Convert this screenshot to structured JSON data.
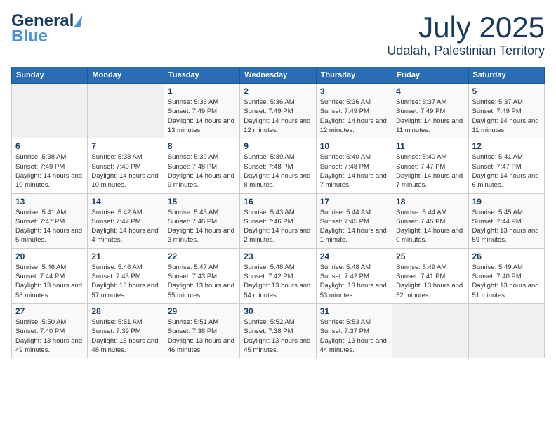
{
  "header": {
    "logo_general": "General",
    "logo_blue": "Blue",
    "month": "July 2025",
    "location": "Udalah, Palestinian Territory"
  },
  "weekdays": [
    "Sunday",
    "Monday",
    "Tuesday",
    "Wednesday",
    "Thursday",
    "Friday",
    "Saturday"
  ],
  "weeks": [
    [
      {
        "day": "",
        "info": ""
      },
      {
        "day": "",
        "info": ""
      },
      {
        "day": "1",
        "info": "Sunrise: 5:36 AM\nSunset: 7:49 PM\nDaylight: 14 hours and 13 minutes."
      },
      {
        "day": "2",
        "info": "Sunrise: 5:36 AM\nSunset: 7:49 PM\nDaylight: 14 hours and 12 minutes."
      },
      {
        "day": "3",
        "info": "Sunrise: 5:36 AM\nSunset: 7:49 PM\nDaylight: 14 hours and 12 minutes."
      },
      {
        "day": "4",
        "info": "Sunrise: 5:37 AM\nSunset: 7:49 PM\nDaylight: 14 hours and 11 minutes."
      },
      {
        "day": "5",
        "info": "Sunrise: 5:37 AM\nSunset: 7:49 PM\nDaylight: 14 hours and 11 minutes."
      }
    ],
    [
      {
        "day": "6",
        "info": "Sunrise: 5:38 AM\nSunset: 7:49 PM\nDaylight: 14 hours and 10 minutes."
      },
      {
        "day": "7",
        "info": "Sunrise: 5:38 AM\nSunset: 7:49 PM\nDaylight: 14 hours and 10 minutes."
      },
      {
        "day": "8",
        "info": "Sunrise: 5:39 AM\nSunset: 7:48 PM\nDaylight: 14 hours and 9 minutes."
      },
      {
        "day": "9",
        "info": "Sunrise: 5:39 AM\nSunset: 7:48 PM\nDaylight: 14 hours and 8 minutes."
      },
      {
        "day": "10",
        "info": "Sunrise: 5:40 AM\nSunset: 7:48 PM\nDaylight: 14 hours and 7 minutes."
      },
      {
        "day": "11",
        "info": "Sunrise: 5:40 AM\nSunset: 7:47 PM\nDaylight: 14 hours and 7 minutes."
      },
      {
        "day": "12",
        "info": "Sunrise: 5:41 AM\nSunset: 7:47 PM\nDaylight: 14 hours and 6 minutes."
      }
    ],
    [
      {
        "day": "13",
        "info": "Sunrise: 5:41 AM\nSunset: 7:47 PM\nDaylight: 14 hours and 5 minutes."
      },
      {
        "day": "14",
        "info": "Sunrise: 5:42 AM\nSunset: 7:47 PM\nDaylight: 14 hours and 4 minutes."
      },
      {
        "day": "15",
        "info": "Sunrise: 5:43 AM\nSunset: 7:46 PM\nDaylight: 14 hours and 3 minutes."
      },
      {
        "day": "16",
        "info": "Sunrise: 5:43 AM\nSunset: 7:46 PM\nDaylight: 14 hours and 2 minutes."
      },
      {
        "day": "17",
        "info": "Sunrise: 5:44 AM\nSunset: 7:45 PM\nDaylight: 14 hours and 1 minute."
      },
      {
        "day": "18",
        "info": "Sunrise: 5:44 AM\nSunset: 7:45 PM\nDaylight: 14 hours and 0 minutes."
      },
      {
        "day": "19",
        "info": "Sunrise: 5:45 AM\nSunset: 7:44 PM\nDaylight: 13 hours and 59 minutes."
      }
    ],
    [
      {
        "day": "20",
        "info": "Sunrise: 5:46 AM\nSunset: 7:44 PM\nDaylight: 13 hours and 58 minutes."
      },
      {
        "day": "21",
        "info": "Sunrise: 5:46 AM\nSunset: 7:43 PM\nDaylight: 13 hours and 57 minutes."
      },
      {
        "day": "22",
        "info": "Sunrise: 5:47 AM\nSunset: 7:43 PM\nDaylight: 13 hours and 55 minutes."
      },
      {
        "day": "23",
        "info": "Sunrise: 5:48 AM\nSunset: 7:42 PM\nDaylight: 13 hours and 54 minutes."
      },
      {
        "day": "24",
        "info": "Sunrise: 5:48 AM\nSunset: 7:42 PM\nDaylight: 13 hours and 53 minutes."
      },
      {
        "day": "25",
        "info": "Sunrise: 5:49 AM\nSunset: 7:41 PM\nDaylight: 13 hours and 52 minutes."
      },
      {
        "day": "26",
        "info": "Sunrise: 5:49 AM\nSunset: 7:40 PM\nDaylight: 13 hours and 51 minutes."
      }
    ],
    [
      {
        "day": "27",
        "info": "Sunrise: 5:50 AM\nSunset: 7:40 PM\nDaylight: 13 hours and 49 minutes."
      },
      {
        "day": "28",
        "info": "Sunrise: 5:51 AM\nSunset: 7:39 PM\nDaylight: 13 hours and 48 minutes."
      },
      {
        "day": "29",
        "info": "Sunrise: 5:51 AM\nSunset: 7:38 PM\nDaylight: 13 hours and 46 minutes."
      },
      {
        "day": "30",
        "info": "Sunrise: 5:52 AM\nSunset: 7:38 PM\nDaylight: 13 hours and 45 minutes."
      },
      {
        "day": "31",
        "info": "Sunrise: 5:53 AM\nSunset: 7:37 PM\nDaylight: 13 hours and 44 minutes."
      },
      {
        "day": "",
        "info": ""
      },
      {
        "day": "",
        "info": ""
      }
    ]
  ]
}
